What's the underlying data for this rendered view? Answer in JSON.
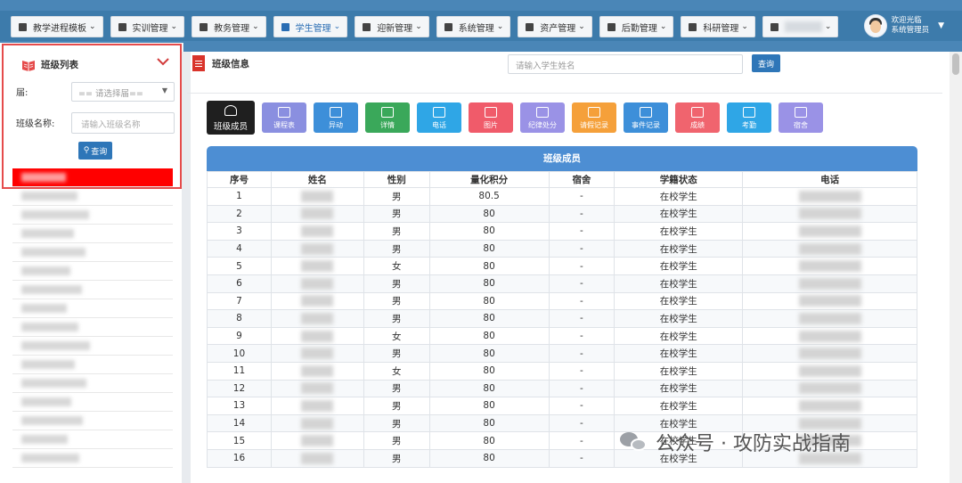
{
  "nav": {
    "items": [
      {
        "label": "教学进程模板",
        "icon": "book-icon"
      },
      {
        "label": "实训管理",
        "icon": "paperclip-icon"
      },
      {
        "label": "教务管理",
        "icon": "book-icon"
      },
      {
        "label": "学生管理",
        "icon": "user-icon",
        "active": true
      },
      {
        "label": "迎新管理",
        "icon": "megaphone-icon"
      },
      {
        "label": "系统管理",
        "icon": "gear-icon"
      },
      {
        "label": "资产管理",
        "icon": "yen-icon"
      },
      {
        "label": "后勤管理",
        "icon": "home-icon"
      },
      {
        "label": "科研管理",
        "icon": "pen-icon"
      },
      {
        "label": "",
        "icon": "flag-icon"
      }
    ],
    "user_welcome": "欢迎光临",
    "user_role": "系统管理员"
  },
  "sidebar": {
    "title": "班级列表",
    "grade_label": "届:",
    "grade_placeholder": "== 请选择届==",
    "class_label": "班级名称:",
    "class_placeholder": "请输入班级名称",
    "search_button": "查询",
    "class_rows": 16
  },
  "main": {
    "title": "班级信息",
    "student_search_placeholder": "请输入学生姓名",
    "search_button": "查询",
    "actions": [
      {
        "label": "班级成员",
        "color": "#1f1f1f"
      },
      {
        "label": "课程表",
        "color": "#8a8fe0"
      },
      {
        "label": "异动",
        "color": "#3d8fd9"
      },
      {
        "label": "详情",
        "color": "#3aa85a"
      },
      {
        "label": "电话",
        "color": "#2fa6e6"
      },
      {
        "label": "图片",
        "color": "#f05b6a"
      },
      {
        "label": "纪律处分",
        "color": "#9a92e6"
      },
      {
        "label": "请假记录",
        "color": "#f5a03a"
      },
      {
        "label": "事件记录",
        "color": "#3d8fd9"
      },
      {
        "label": "成绩",
        "color": "#f0646e"
      },
      {
        "label": "考勤",
        "color": "#2fa6e6"
      },
      {
        "label": "宿舍",
        "color": "#9a92e6"
      }
    ],
    "table": {
      "caption": "班级成员",
      "headers": [
        "序号",
        "姓名",
        "性别",
        "量化积分",
        "宿舍",
        "学籍状态",
        "电话"
      ],
      "rows": [
        {
          "no": "1",
          "gender": "男",
          "score": "80.5",
          "dorm": "-",
          "status": "在校学生"
        },
        {
          "no": "2",
          "gender": "男",
          "score": "80",
          "dorm": "-",
          "status": "在校学生"
        },
        {
          "no": "3",
          "gender": "男",
          "score": "80",
          "dorm": "-",
          "status": "在校学生"
        },
        {
          "no": "4",
          "gender": "男",
          "score": "80",
          "dorm": "-",
          "status": "在校学生"
        },
        {
          "no": "5",
          "gender": "女",
          "score": "80",
          "dorm": "-",
          "status": "在校学生"
        },
        {
          "no": "6",
          "gender": "男",
          "score": "80",
          "dorm": "-",
          "status": "在校学生"
        },
        {
          "no": "7",
          "gender": "男",
          "score": "80",
          "dorm": "-",
          "status": "在校学生"
        },
        {
          "no": "8",
          "gender": "男",
          "score": "80",
          "dorm": "-",
          "status": "在校学生"
        },
        {
          "no": "9",
          "gender": "女",
          "score": "80",
          "dorm": "-",
          "status": "在校学生"
        },
        {
          "no": "10",
          "gender": "男",
          "score": "80",
          "dorm": "-",
          "status": "在校学生"
        },
        {
          "no": "11",
          "gender": "女",
          "score": "80",
          "dorm": "-",
          "status": "在校学生"
        },
        {
          "no": "12",
          "gender": "男",
          "score": "80",
          "dorm": "-",
          "status": "在校学生"
        },
        {
          "no": "13",
          "gender": "男",
          "score": "80",
          "dorm": "-",
          "status": "在校学生"
        },
        {
          "no": "14",
          "gender": "男",
          "score": "80",
          "dorm": "-",
          "status": "在校学生"
        },
        {
          "no": "15",
          "gender": "男",
          "score": "80",
          "dorm": "-",
          "status": "在校学生"
        },
        {
          "no": "16",
          "gender": "男",
          "score": "80",
          "dorm": "-",
          "status": "在校学生"
        }
      ]
    }
  },
  "watermark": "公众号 · 攻防实战指南"
}
